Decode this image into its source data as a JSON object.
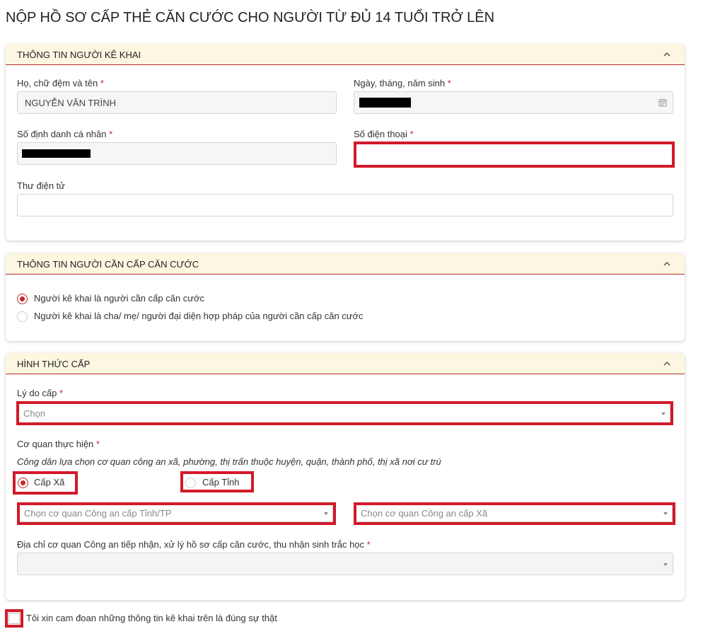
{
  "page": {
    "title": "NỘP HỒ SƠ CẤP THẺ CĂN CƯỚC CHO NGƯỜI TỪ ĐỦ 14 TUỔI TRỞ LÊN"
  },
  "section1": {
    "header": "THÔNG TIN NGƯỜI KÊ KHAI",
    "name_label": "Họ, chữ đệm và tên",
    "name_value": "NGUYỄN VĂN TRÌNH",
    "dob_label": "Ngày, tháng, năm sinh",
    "id_label": "Số định danh cá nhân",
    "phone_label": "Số điện thoại",
    "phone_value": "",
    "email_label": "Thư điện tử",
    "email_value": ""
  },
  "section2": {
    "header": "THÔNG TIN NGƯỜI CẦN CẤP CĂN CƯỚC",
    "option1": "Người kê khai là người cần cấp căn cước",
    "option2": "Người kê khai là cha/ mẹ/ người đại diện hợp pháp của người cần cấp căn cước"
  },
  "section3": {
    "header": "HÌNH THỨC CẤP",
    "reason_label": "Lý do cấp",
    "reason_placeholder": "Chọn",
    "agency_label": "Cơ quan thực hiện",
    "agency_hint": "Công dân lựa chọn cơ quan công an xã, phường, thị trấn thuộc huyện, quận, thành phố, thị xã nơi cư trú",
    "level_commune": "Cấp Xã",
    "level_province": "Cấp Tỉnh",
    "province_placeholder": "Chọn cơ quan Công an cấp Tỉnh/TP",
    "commune_placeholder": "Chọn cơ quan Công an cấp Xã",
    "address_label": "Địa chỉ cơ quan Công an tiếp nhận, xử lý hồ sơ cấp căn cước, thu nhận sinh trắc học"
  },
  "commitment": "Tôi xin cam đoan những thông tin kê khai trên là đúng sự thật",
  "required_mark": "*",
  "colors": {
    "accent": "#c62828",
    "header_bg": "#fdf6e1",
    "highlight": "#d11a2a"
  }
}
